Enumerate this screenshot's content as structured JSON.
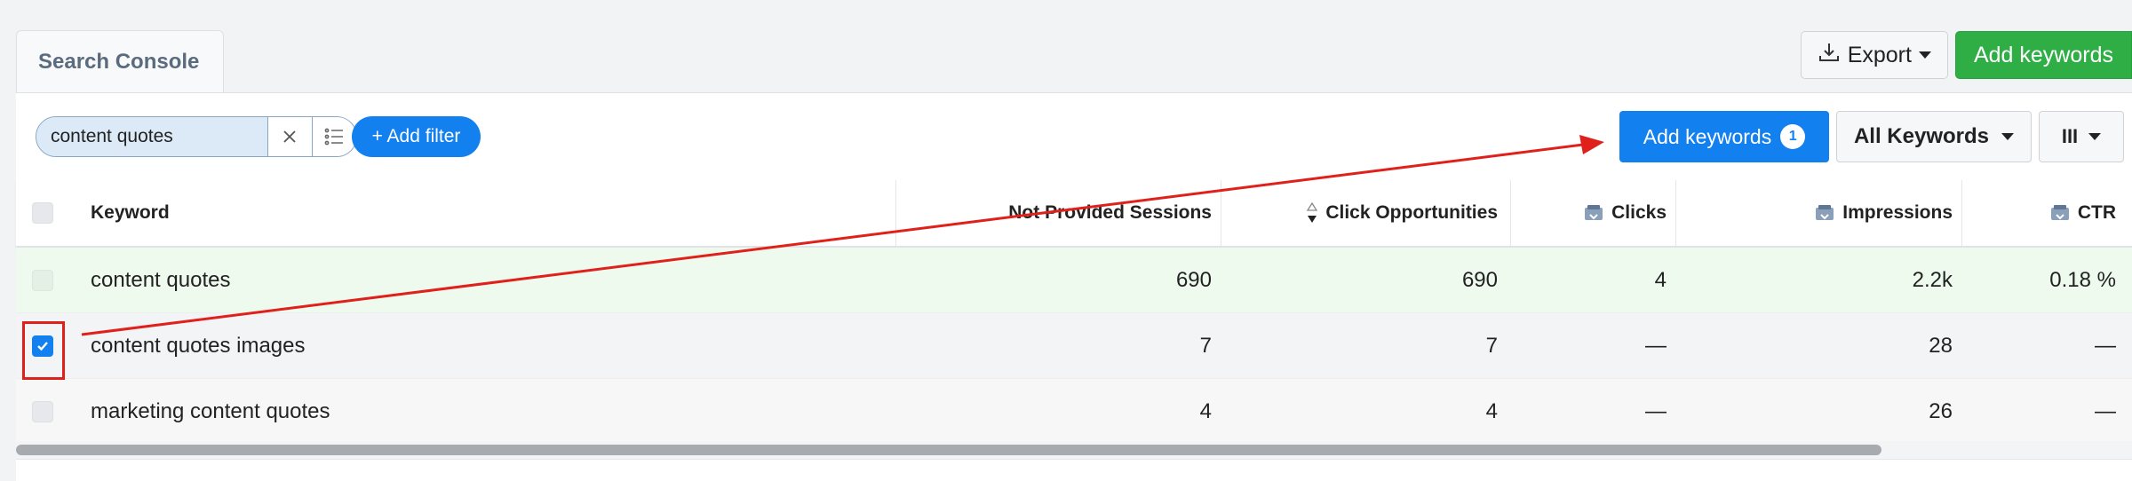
{
  "tabs": [
    {
      "label": "Search Console"
    }
  ],
  "toolbar": {
    "export_label": "Export",
    "add_keywords_top_label": "Add keywords"
  },
  "filters": {
    "search_value": "content quotes",
    "add_filter_label": "+ Add filter"
  },
  "actions": {
    "add_keywords_label": "Add keywords",
    "add_keywords_count": "1",
    "all_keywords_label": "All Keywords",
    "columns_label": "III"
  },
  "table": {
    "headers": {
      "keyword": "Keyword",
      "not_provided_sessions": "Not Provided Sessions",
      "click_opportunities": "Click Opportunities",
      "clicks": "Clicks",
      "impressions": "Impressions",
      "ctr": "CTR"
    },
    "rows": [
      {
        "keyword": "content quotes",
        "not_provided_sessions": "690",
        "click_opportunities": "690",
        "clicks": "4",
        "impressions": "2.2k",
        "ctr": "0.18 %",
        "checked": false
      },
      {
        "keyword": "content quotes images",
        "not_provided_sessions": "7",
        "click_opportunities": "7",
        "clicks": "—",
        "impressions": "28",
        "ctr": "—",
        "checked": true
      },
      {
        "keyword": "marketing content quotes",
        "not_provided_sessions": "4",
        "click_opportunities": "4",
        "clicks": "—",
        "impressions": "26",
        "ctr": "—",
        "checked": false
      }
    ]
  },
  "colors": {
    "primary_blue": "#1380f0",
    "green": "#2eae45",
    "annotation_red": "#e0201a"
  }
}
